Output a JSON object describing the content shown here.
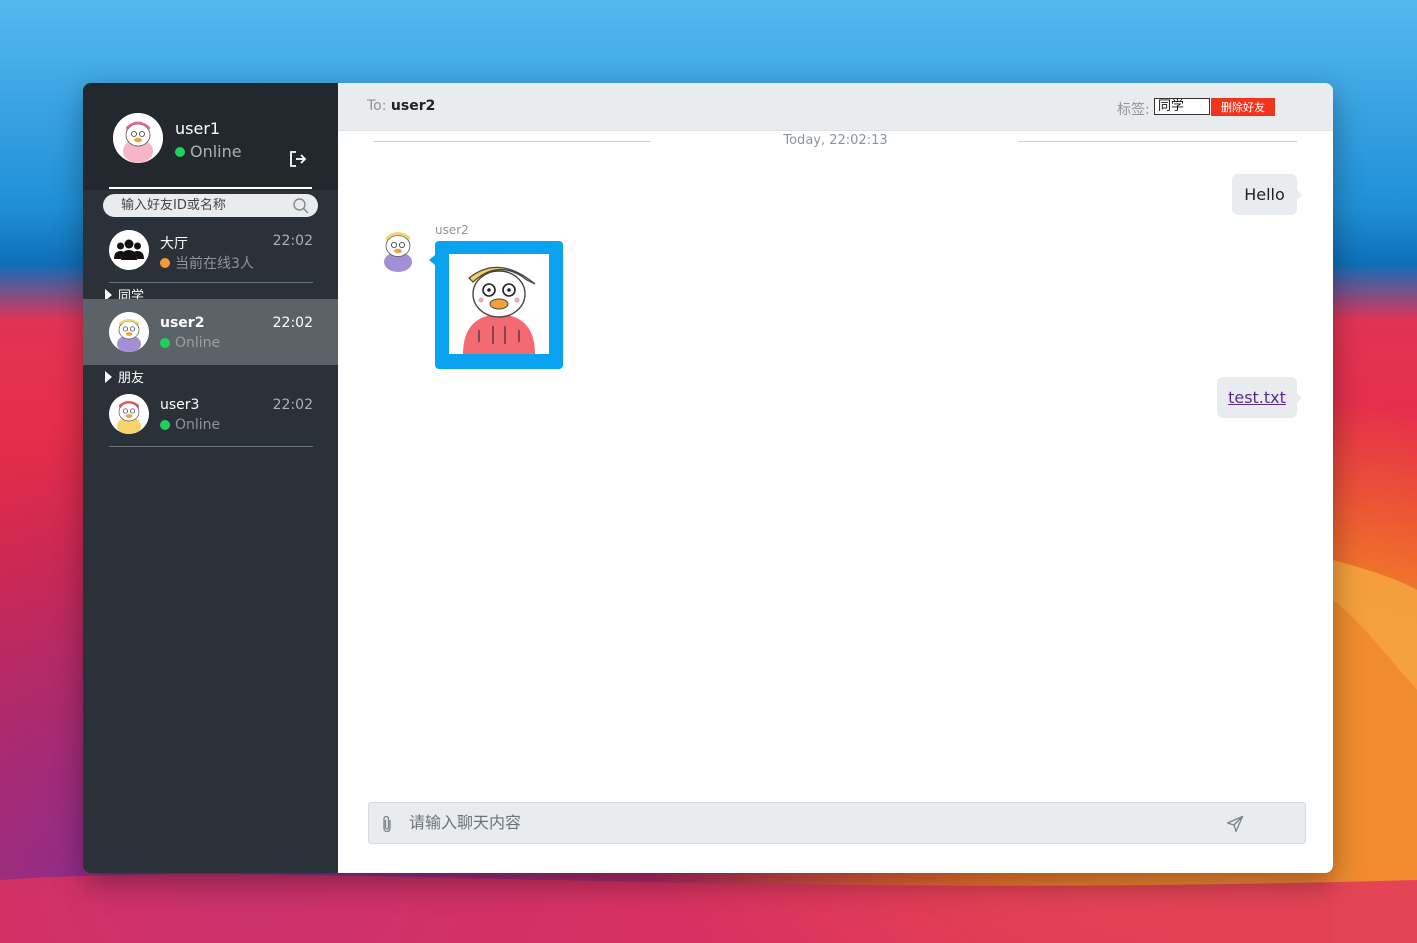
{
  "me": {
    "name": "user1",
    "status": "Online"
  },
  "search": {
    "placeholder": "输入好友ID或名称"
  },
  "lobby": {
    "name": "大厅",
    "time": "22:02",
    "status": "当前在线3人"
  },
  "groups": [
    {
      "label": "同学",
      "contacts": [
        {
          "name": "user2",
          "time": "22:02",
          "status": "Online"
        }
      ]
    },
    {
      "label": "朋友",
      "contacts": [
        {
          "name": "user3",
          "time": "22:02",
          "status": "Online"
        }
      ]
    }
  ],
  "header": {
    "to_prefix": "To:",
    "to_name": "user2",
    "tag_label": "标签:",
    "tag_value": "同学",
    "delete_label": "删除好友"
  },
  "chat": {
    "date": "Today, 22:02:13",
    "messages": [
      {
        "direction": "out",
        "type": "text",
        "text": "Hello"
      },
      {
        "direction": "in",
        "type": "image",
        "sender": "user2"
      },
      {
        "direction": "out",
        "type": "file",
        "text": "test.txt"
      }
    ]
  },
  "composer": {
    "placeholder": "请输入聊天内容"
  },
  "colors": {
    "sidebar": "#2b3138",
    "active": "#5b6268",
    "online": "#1dd15b",
    "lobby_dot": "#f39c3a",
    "image_bubble": "#0aa3ef",
    "delete_button": "#f0341e"
  },
  "icons": [
    "logout-icon",
    "search-icon",
    "group-icon",
    "attach-icon",
    "send-icon"
  ]
}
